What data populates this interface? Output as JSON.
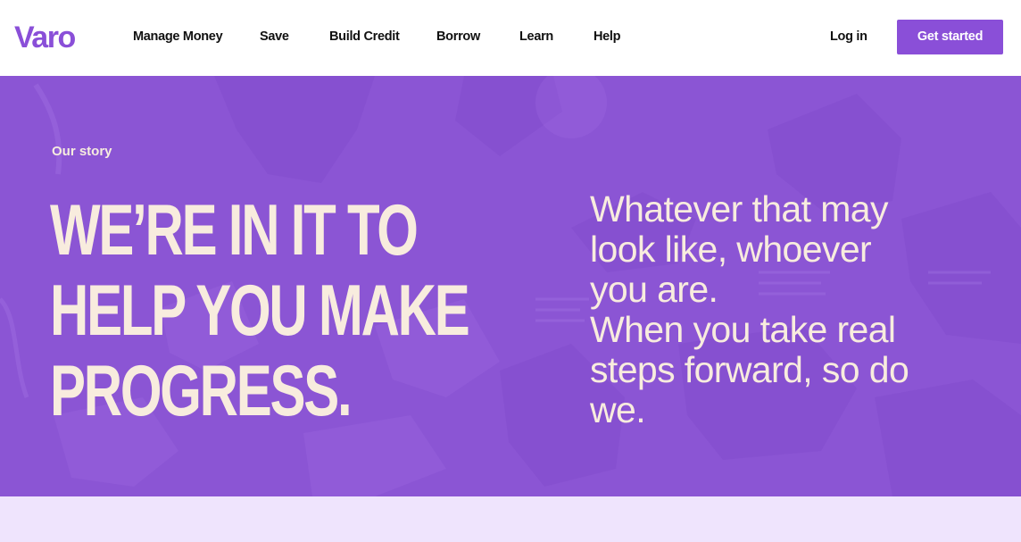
{
  "header": {
    "logo": "Varo",
    "nav": [
      {
        "label": "Manage Money"
      },
      {
        "label": "Save"
      },
      {
        "label": "Build Credit"
      },
      {
        "label": "Borrow"
      },
      {
        "label": "Learn"
      },
      {
        "label": "Help"
      }
    ],
    "login_label": "Log in",
    "cta_label": "Get started"
  },
  "hero": {
    "eyebrow": "Our story",
    "headline_lines": [
      "WE’RE IN IT TO",
      "HELP YOU MAKE",
      "PROGRESS."
    ],
    "subhead_lines": [
      "Whatever that may",
      "look like, whoever",
      "you are.",
      "When you take real",
      "steps forward, so do",
      "we."
    ]
  },
  "colors": {
    "brand_purple": "#8a4fd8",
    "hero_background": "#8b55d4",
    "hero_text": "#f8ecde",
    "next_section_background": "#efe4fd"
  }
}
